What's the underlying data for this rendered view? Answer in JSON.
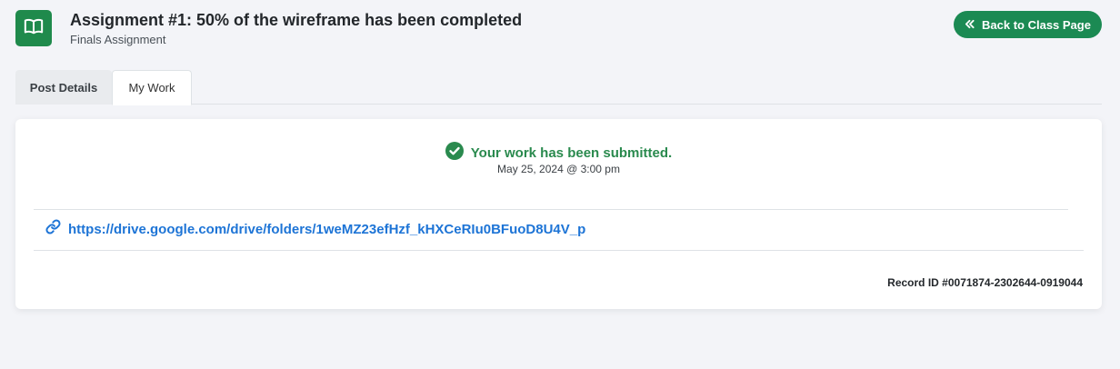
{
  "header": {
    "icon": "open-book-icon",
    "title": "Assignment #1: 50% of the wireframe has been completed",
    "subtitle": "Finals Assignment",
    "back_button": {
      "icon": "double-chevron-left-icon",
      "label": "Back to Class Page"
    }
  },
  "tabs": [
    {
      "label": "Post Details",
      "active": false
    },
    {
      "label": "My Work",
      "active": true
    }
  ],
  "submission": {
    "status_icon": "check-circle-icon",
    "status_text": "Your work has been submitted.",
    "date": "May 25, 2024 @ 3:00 pm",
    "link_icon": "link-icon",
    "link": "https://drive.google.com/drive/folders/1weMZ23efHzf_kHXCeRIu0BFuoD8U4V_p",
    "record_id": "Record ID #0071874-2302644-0919044"
  },
  "colors": {
    "brand_green": "#1f8a4c",
    "status_green": "#2a8a4e",
    "link_blue": "#1d74d6",
    "page_background": "#f3f4f8"
  }
}
